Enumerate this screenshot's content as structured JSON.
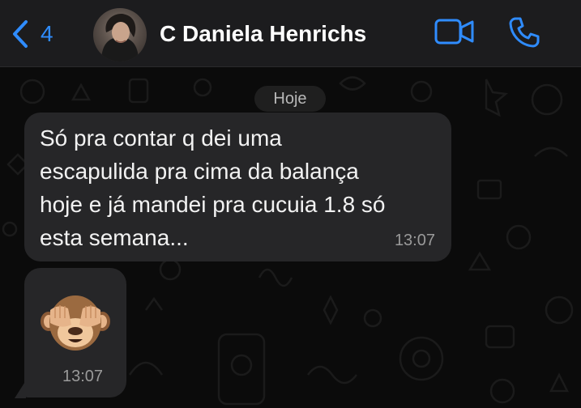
{
  "header": {
    "back_count": "4",
    "contact_name": "C Daniela Henrichs",
    "accent": "#2f8cff",
    "icons": [
      "chevron-left-icon",
      "video-call-icon",
      "phone-icon"
    ]
  },
  "chat": {
    "date_label": "Hoje",
    "messages": [
      {
        "text": "Só pra contar q dei uma\nescapulida pra cima da balança\nhoje e já mandei pra cucuia 1.8 só\nesta semana...",
        "time": "13:07"
      },
      {
        "emoji": "see-no-evil-monkey",
        "time": "13:07"
      }
    ]
  }
}
